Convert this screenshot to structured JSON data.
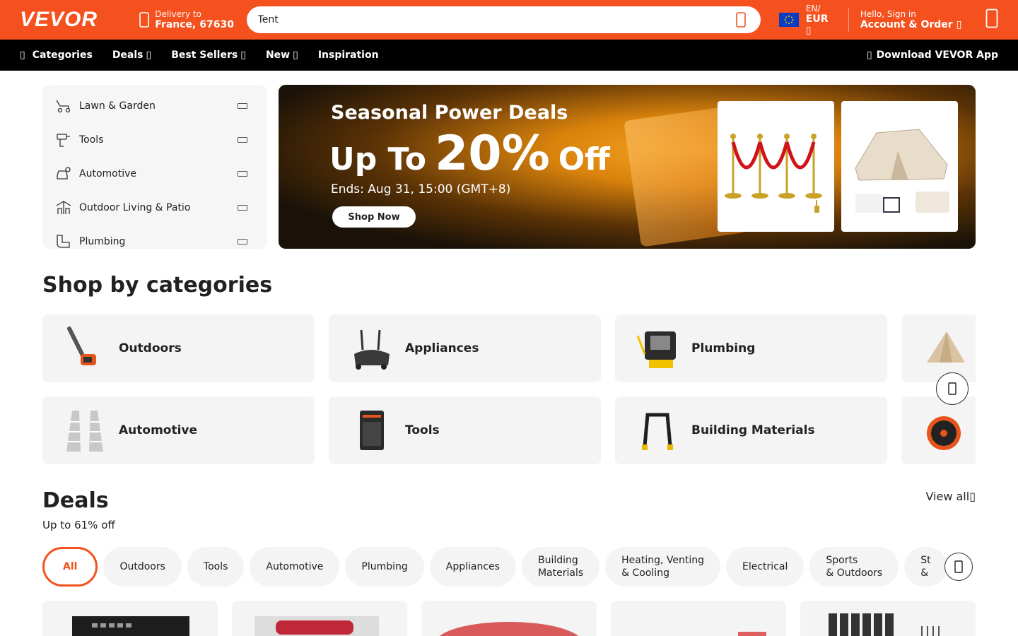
{
  "header": {
    "logo": "VEVOR",
    "delivery_label": "Delivery to",
    "delivery_location": "France, 67630",
    "search_value": "Tent",
    "lang_label": "EN/",
    "currency_label": "EUR",
    "signin_label": "Hello, Sign in",
    "account_label": "Account & Order"
  },
  "nav": {
    "categories": "Categories",
    "deals": "Deals",
    "best_sellers": "Best Sellers",
    "new": "New",
    "inspiration": "Inspiration",
    "app": "Download VEVOR App"
  },
  "category_menu": [
    {
      "label": "Lawn & Garden",
      "icon": "lawn-mower-icon"
    },
    {
      "label": "Tools",
      "icon": "drill-icon"
    },
    {
      "label": "Automotive",
      "icon": "car-service-icon"
    },
    {
      "label": "Outdoor Living & Patio",
      "icon": "patio-icon"
    },
    {
      "label": "Plumbing",
      "icon": "pipe-icon"
    }
  ],
  "banner": {
    "title": "Seasonal Power Deals",
    "promo_prefix": "Up To",
    "promo_value": "20%",
    "promo_suffix": "Off",
    "ends": "Ends: Aug 31, 15:00 (GMT+8)",
    "cta": "Shop Now"
  },
  "shop_by_categories": {
    "title": "Shop by categories",
    "tiles": [
      {
        "label": "Outdoors"
      },
      {
        "label": "Appliances"
      },
      {
        "label": "Plumbing"
      },
      {
        "label": ""
      },
      {
        "label": "Automotive"
      },
      {
        "label": "Tools"
      },
      {
        "label": "Building Materials"
      },
      {
        "label": ""
      }
    ]
  },
  "deals": {
    "title": "Deals",
    "subtitle": "Up to 61% off",
    "view_all": "View all",
    "chips": [
      "All",
      "Outdoors",
      "Tools",
      "Automotive",
      "Plumbing",
      "Appliances",
      "Building\nMaterials",
      "Heating, Venting\n& Cooling",
      "Electrical",
      "Sports\n& Outdoors",
      "St\n&"
    ]
  },
  "colors": {
    "brand": "#f4511e",
    "nav": "#000000"
  }
}
